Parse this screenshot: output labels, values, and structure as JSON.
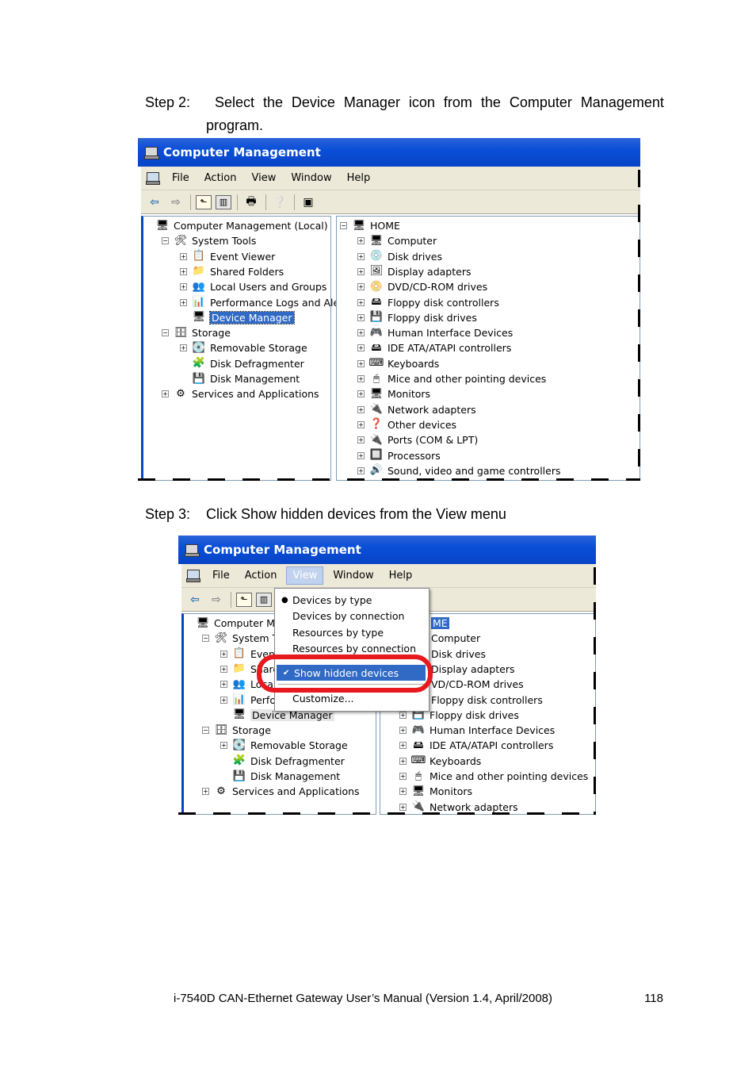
{
  "step2": {
    "label": "Step 2:",
    "words": [
      "Select",
      "the",
      "Device",
      "Manager",
      "icon",
      "from",
      "the",
      "Computer",
      "Management"
    ],
    "line2": "program."
  },
  "step3": {
    "label": "Step 3:",
    "text": "Click Show hidden devices from the View menu"
  },
  "footer": {
    "manual": "i-7540D CAN-Ethernet Gateway User’s Manual (Version 1.4, April/2008)",
    "page": "118"
  },
  "window": {
    "title": "Computer Management",
    "menu": [
      "File",
      "Action",
      "View",
      "Window",
      "Help"
    ]
  },
  "tree1": [
    {
      "label": "Computer Management (Local)",
      "exp": "",
      "icon": "computer-icon",
      "glyph": "🖥"
    },
    {
      "label": "System Tools",
      "exp": "−",
      "icon": "tools-icon",
      "glyph": "🛠"
    },
    {
      "label": "Event Viewer",
      "exp": "+",
      "icon": "event-viewer-icon",
      "glyph": "📋"
    },
    {
      "label": "Shared Folders",
      "exp": "+",
      "icon": "folder-icon",
      "glyph": "📁"
    },
    {
      "label": "Local Users and Groups",
      "exp": "+",
      "icon": "users-icon",
      "glyph": "👥"
    },
    {
      "label": "Performance Logs and Alerts",
      "exp": "+",
      "icon": "performance-icon",
      "glyph": "📊"
    },
    {
      "label": "Device Manager",
      "exp": "",
      "icon": "device-manager-icon",
      "glyph": "🖥"
    },
    {
      "label": "Storage",
      "exp": "−",
      "icon": "storage-icon",
      "glyph": "🗄"
    },
    {
      "label": "Removable Storage",
      "exp": "+",
      "icon": "removable-storage-icon",
      "glyph": "💽"
    },
    {
      "label": "Disk Defragmenter",
      "exp": "",
      "icon": "defragmenter-icon",
      "glyph": "🧩"
    },
    {
      "label": "Disk Management",
      "exp": "",
      "icon": "disk-management-icon",
      "glyph": "💾"
    },
    {
      "label": "Services and Applications",
      "exp": "+",
      "icon": "services-icon",
      "glyph": "⚙"
    }
  ],
  "devices1": [
    {
      "label": "HOME",
      "exp": "−",
      "icon": "computer-icon",
      "glyph": "🖥"
    },
    {
      "label": "Computer",
      "exp": "+",
      "icon": "computer-icon",
      "glyph": "🖥"
    },
    {
      "label": "Disk drives",
      "exp": "+",
      "icon": "disk-drive-icon",
      "glyph": "💿"
    },
    {
      "label": "Display adapters",
      "exp": "+",
      "icon": "display-adapter-icon",
      "glyph": "🖼"
    },
    {
      "label": "DVD/CD-ROM drives",
      "exp": "+",
      "icon": "dvd-icon",
      "glyph": "📀"
    },
    {
      "label": "Floppy disk controllers",
      "exp": "+",
      "icon": "floppy-controller-icon",
      "glyph": "🖴"
    },
    {
      "label": "Floppy disk drives",
      "exp": "+",
      "icon": "floppy-drive-icon",
      "glyph": "💾"
    },
    {
      "label": "Human Interface Devices",
      "exp": "+",
      "icon": "hid-icon",
      "glyph": "🎮"
    },
    {
      "label": "IDE ATA/ATAPI controllers",
      "exp": "+",
      "icon": "ide-icon",
      "glyph": "🖴"
    },
    {
      "label": "Keyboards",
      "exp": "+",
      "icon": "keyboard-icon",
      "glyph": "⌨"
    },
    {
      "label": "Mice and other pointing devices",
      "exp": "+",
      "icon": "mouse-icon",
      "glyph": "🖱"
    },
    {
      "label": "Monitors",
      "exp": "+",
      "icon": "monitor-icon",
      "glyph": "🖥"
    },
    {
      "label": "Network adapters",
      "exp": "+",
      "icon": "network-icon",
      "glyph": "🔌"
    },
    {
      "label": "Other devices",
      "exp": "+",
      "icon": "other-devices-icon",
      "glyph": "❓"
    },
    {
      "label": "Ports (COM & LPT)",
      "exp": "+",
      "icon": "port-icon",
      "glyph": "🔌"
    },
    {
      "label": "Processors",
      "exp": "+",
      "icon": "processor-icon",
      "glyph": "🔲"
    },
    {
      "label": "Sound, video and game controllers",
      "exp": "+",
      "icon": "sound-icon",
      "glyph": "🔊"
    }
  ],
  "tree2": [
    {
      "label": "Computer Mana",
      "exp": "",
      "icon": "computer-icon",
      "glyph": "🖥"
    },
    {
      "label": "System Toc",
      "exp": "−",
      "icon": "tools-icon",
      "glyph": "🛠"
    },
    {
      "label": "Event",
      "exp": "+",
      "icon": "event-viewer-icon",
      "glyph": "📋"
    },
    {
      "label": "Shared",
      "exp": "+",
      "icon": "folder-icon",
      "glyph": "📁"
    },
    {
      "label": "Local",
      "exp": "+",
      "icon": "users-icon",
      "glyph": "👥"
    },
    {
      "label": "Perform",
      "exp": "+",
      "icon": "performance-icon",
      "glyph": "📊"
    },
    {
      "label": "Device Manager",
      "exp": "",
      "icon": "device-manager-icon",
      "glyph": "🖥"
    },
    {
      "label": "Storage",
      "exp": "−",
      "icon": "storage-icon",
      "glyph": "🗄"
    },
    {
      "label": "Removable Storage",
      "exp": "+",
      "icon": "removable-storage-icon",
      "glyph": "💽"
    },
    {
      "label": "Disk Defragmenter",
      "exp": "",
      "icon": "defragmenter-icon",
      "glyph": "🧩"
    },
    {
      "label": "Disk Management",
      "exp": "",
      "icon": "disk-management-icon",
      "glyph": "💾"
    },
    {
      "label": "Services and Applications",
      "exp": "+",
      "icon": "services-icon",
      "glyph": "⚙"
    }
  ],
  "devices2": [
    {
      "label": "ME",
      "exp": "",
      "icon": "",
      "glyph": ""
    },
    {
      "label": "Computer",
      "exp": "",
      "icon": "",
      "glyph": ""
    },
    {
      "label": "Disk drives",
      "exp": "",
      "icon": "",
      "glyph": ""
    },
    {
      "label": "Display adapters",
      "exp": "",
      "icon": "",
      "glyph": ""
    },
    {
      "label": "VD/CD-ROM drives",
      "exp": "",
      "icon": "",
      "glyph": ""
    },
    {
      "label": "Floppy disk controllers",
      "exp": "",
      "icon": "",
      "glyph": ""
    },
    {
      "label": "Floppy disk drives",
      "exp": "+",
      "icon": "floppy-drive-icon",
      "glyph": "💾"
    },
    {
      "label": "Human Interface Devices",
      "exp": "+",
      "icon": "hid-icon",
      "glyph": "🎮"
    },
    {
      "label": "IDE ATA/ATAPI controllers",
      "exp": "+",
      "icon": "ide-icon",
      "glyph": "🖴"
    },
    {
      "label": "Keyboards",
      "exp": "+",
      "icon": "keyboard-icon",
      "glyph": "⌨"
    },
    {
      "label": "Mice and other pointing devices",
      "exp": "+",
      "icon": "mouse-icon",
      "glyph": "🖱"
    },
    {
      "label": "Monitors",
      "exp": "+",
      "icon": "monitor-icon",
      "glyph": "🖥"
    },
    {
      "label": "Network adapters",
      "exp": "+",
      "icon": "network-icon",
      "glyph": "🔌"
    }
  ],
  "viewMenu": {
    "items": [
      "Devices by type",
      "Devices by connection",
      "Resources by type",
      "Resources by connection"
    ],
    "selected_mark": "●",
    "show_hidden": "Show hidden devices",
    "check_mark": "✔",
    "customize": "Customize..."
  },
  "colors": {
    "titlebar": "#0a4fd8",
    "selection": "#316ac5",
    "highlight_ring": "#e8181f"
  }
}
